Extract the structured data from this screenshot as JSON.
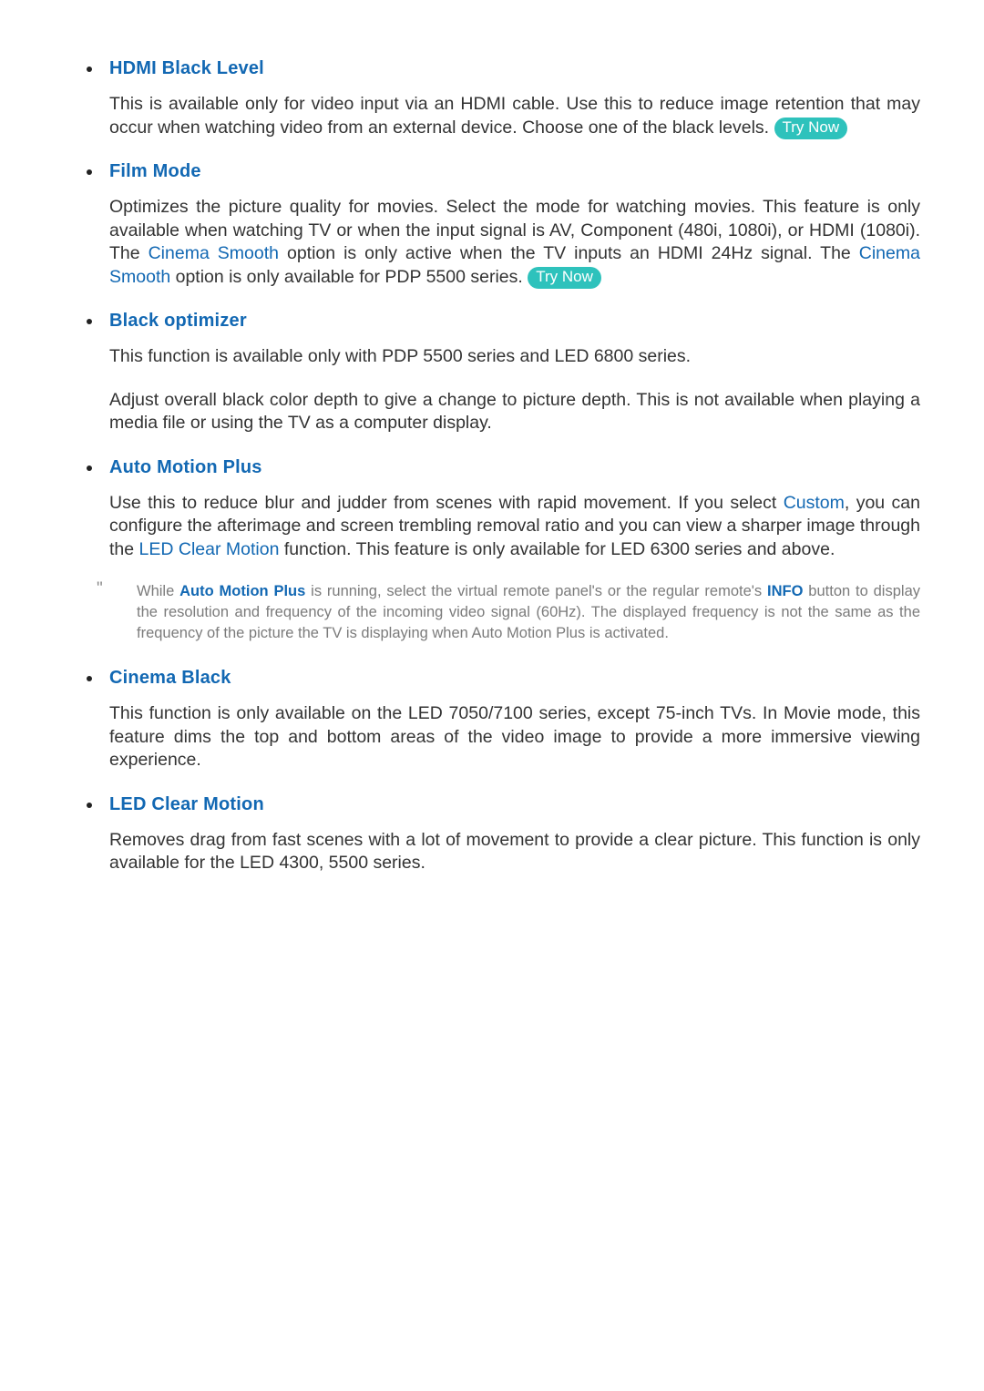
{
  "document": {
    "type": "e-manual-page",
    "background_color": "#ffffff",
    "accent_blue": "#1268b3",
    "body_color": "#333333",
    "note_color": "#7b7b7b",
    "badge_color": "#2ec2bc",
    "badge_text_color": "#ffffff"
  },
  "sections": [
    {
      "id": "hdmi-black-level",
      "heading": "HDMI Black Level",
      "paragraphs": [
        {
          "id": "hdmi-black-level-p1",
          "parts": [
            {
              "type": "text",
              "text": "This is available only for video input via an HDMI cable. Use this to reduce image retention that may occur when watching video from an external device. Choose one of the black levels. "
            },
            {
              "type": "badge",
              "text": "Try Now"
            }
          ]
        }
      ]
    },
    {
      "id": "film-mode",
      "heading": "Film Mode",
      "paragraphs": [
        {
          "id": "film-mode-p1",
          "parts": [
            {
              "type": "text",
              "text": "Optimizes the picture quality for movies. Select the mode for watching movies. This feature is only available when watching TV or when the input signal is AV, Component (480i, 1080i), or HDMI (1080i). The "
            },
            {
              "type": "link",
              "text": "Cinema Smooth"
            },
            {
              "type": "text",
              "text": " option is only active when the TV inputs an HDMI 24Hz signal. The "
            },
            {
              "type": "link",
              "text": "Cinema Smooth"
            },
            {
              "type": "text",
              "text": " option is only available for PDP 5500 series. "
            },
            {
              "type": "badge",
              "text": "Try Now"
            }
          ]
        }
      ]
    },
    {
      "id": "black-optimizer",
      "heading": "Black optimizer",
      "paragraphs": [
        {
          "id": "black-optimizer-p1",
          "parts": [
            {
              "type": "text",
              "text": "This function is available only with PDP 5500 series and LED 6800 series."
            }
          ]
        },
        {
          "id": "black-optimizer-p2",
          "parts": [
            {
              "type": "text",
              "text": "Adjust overall black color depth to give a change to picture depth. This is not available when playing a media file or using the TV as a computer display."
            }
          ]
        }
      ]
    },
    {
      "id": "auto-motion-plus",
      "heading": "Auto Motion Plus",
      "paragraphs": [
        {
          "id": "auto-motion-plus-p1",
          "parts": [
            {
              "type": "text",
              "text": "Use this to reduce blur and judder from scenes with rapid movement. If you select "
            },
            {
              "type": "link",
              "text": "Custom"
            },
            {
              "type": "text",
              "text": ", you can configure the afterimage and screen trembling removal ratio and you can view a sharper image through the "
            },
            {
              "type": "link",
              "text": "LED Clear Motion"
            },
            {
              "type": "text",
              "text": " function. This feature is only available for LED 6300 series and above."
            }
          ]
        }
      ],
      "note": {
        "marker": "\"",
        "parts": [
          {
            "type": "text",
            "text": "While "
          },
          {
            "type": "link-strong",
            "text": "Auto Motion Plus"
          },
          {
            "type": "text",
            "text": " is running, select the virtual remote panel's or the regular remote's "
          },
          {
            "type": "link-strong",
            "text": "INFO"
          },
          {
            "type": "text",
            "text": " button to display the resolution and frequency of the incoming video signal (60Hz). The displayed frequency is not the same as the frequency of the picture the TV is displaying when Auto Motion Plus is activated."
          }
        ]
      }
    },
    {
      "id": "cinema-black",
      "heading": "Cinema Black",
      "paragraphs": [
        {
          "id": "cinema-black-p1",
          "parts": [
            {
              "type": "text",
              "text": "This function is only available on the LED 7050/7100 series, except 75-inch TVs. In Movie mode, this feature dims the top and bottom areas of the video image to provide a more immersive viewing experience."
            }
          ]
        }
      ]
    },
    {
      "id": "led-clear-motion",
      "heading": "LED Clear Motion",
      "paragraphs": [
        {
          "id": "led-clear-motion-p1",
          "parts": [
            {
              "type": "text",
              "text": "Removes drag from fast scenes with a lot of movement to provide a clear picture. This function is only available for the LED 4300, 5500 series."
            }
          ]
        }
      ]
    }
  ]
}
